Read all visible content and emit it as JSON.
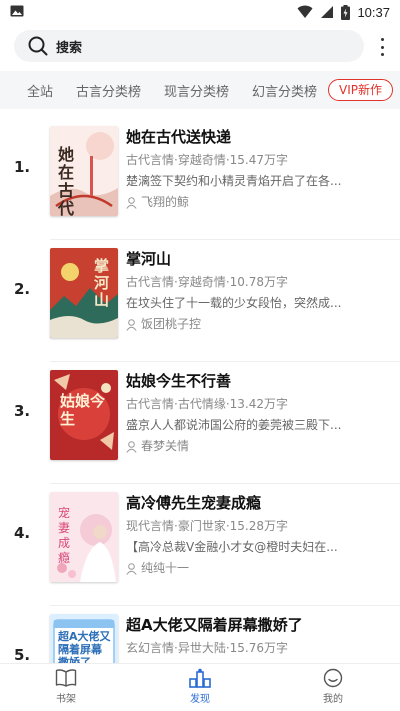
{
  "status_bar": {
    "time": "10:37"
  },
  "search": {
    "label": "搜索"
  },
  "categories": [
    {
      "label": "全站"
    },
    {
      "label": "古言分类榜"
    },
    {
      "label": "现言分类榜"
    },
    {
      "label": "幻言分类榜"
    },
    {
      "label": "VIP新作"
    }
  ],
  "books": [
    {
      "rank": "1.",
      "title": "她在古代送快递",
      "meta": "古代言情·穿越奇情·15.47万字",
      "desc": "楚漓签下契约和小精灵青焰开启了在各...",
      "author": "飞翔的鲸",
      "cover_text": "她在古代"
    },
    {
      "rank": "2.",
      "title": "掌河山",
      "meta": "古代言情·穿越奇情·10.78万字",
      "desc": "在坟头住了十一载的少女段怡，突然成...",
      "author": "饭团桃子控",
      "cover_text": "掌河山"
    },
    {
      "rank": "3.",
      "title": "姑娘今生不行善",
      "meta": "古代言情·古代情缘·13.42万字",
      "desc": "盛京人人都说沛国公府的姜莞被三殿下...",
      "author": "春梦关情",
      "cover_text": "姑娘今生"
    },
    {
      "rank": "4.",
      "title": "高冷傅先生宠妻成瘾",
      "meta": "现代言情·豪门世家·15.28万字",
      "desc": "【高冷总裁V金融小才女@橙时夫妇在...",
      "author": "纯纯十一",
      "cover_text": "宠妻成瘾"
    },
    {
      "rank": "5.",
      "title": "超A大佬又隔着屏幕撒娇了",
      "meta": "玄幻言情·异世大陆·15.76万字",
      "desc": "",
      "author": "",
      "cover_text": "超A大佬又隔着屏幕撒娇了"
    }
  ],
  "bottom_nav": [
    {
      "label": "书架",
      "icon": "book-icon"
    },
    {
      "label": "发现",
      "icon": "discover-icon"
    },
    {
      "label": "我的",
      "icon": "smile-icon"
    }
  ],
  "colors": {
    "accent": "#2b6cd4",
    "vip": "#e0332a"
  }
}
